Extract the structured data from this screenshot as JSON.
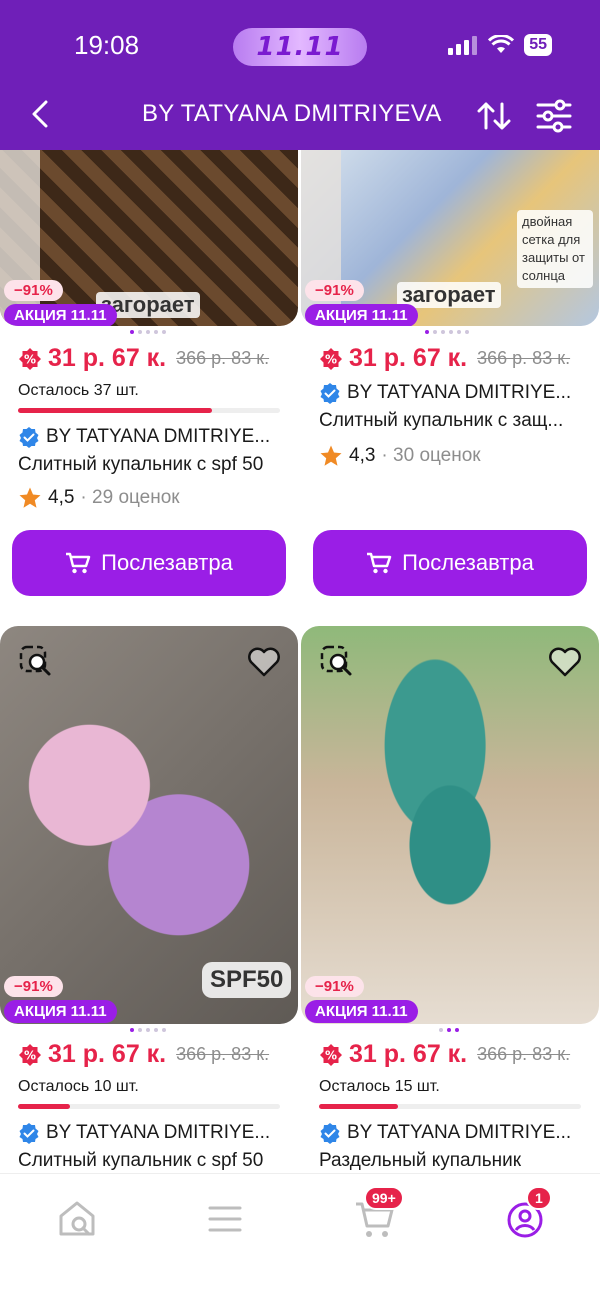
{
  "status_bar": {
    "time": "19:08",
    "promo": "11.11",
    "battery": "55"
  },
  "header": {
    "title": "BY TATYANA DMITRIYEVA"
  },
  "colors": {
    "header_bg": "#6f1fb8",
    "accent": "#9a1ee6",
    "price": "#e6234a"
  },
  "products": [
    {
      "discount": "−91%",
      "promo": "АКЦИЯ 11.11",
      "price": "31 р. 67 к.",
      "old_price": "366 р. 83 к.",
      "stock": "Осталось 37 шт.",
      "stock_fraction": 0.74,
      "brand": "BY TATYANA DMITRIYE...",
      "name": "Слитный купальник с spf 50",
      "rating": "4,5",
      "reviews": "· 29 оценок",
      "cta": "Послезавтра",
      "image_overlay": "загорает"
    },
    {
      "discount": "−91%",
      "promo": "АКЦИЯ 11.11",
      "price": "31 р. 67 к.",
      "old_price": "366 р. 83 к.",
      "brand": "BY TATYANA DMITRIYE...",
      "name": "Слитный купальник с защ...",
      "rating": "4,3",
      "reviews": "· 30 оценок",
      "cta": "Послезавтра",
      "image_overlay": "загорает",
      "image_note": "двойная сетка для защиты от солнца"
    },
    {
      "discount": "−91%",
      "promo": "АКЦИЯ 11.11",
      "price": "31 р. 67 к.",
      "old_price": "366 р. 83 к.",
      "stock": "Осталось 10 шт.",
      "stock_fraction": 0.2,
      "brand": "BY TATYANA DMITRIYE...",
      "name": "Слитный купальник с spf 50",
      "image_tag": "SPF50"
    },
    {
      "discount": "−91%",
      "promo": "АКЦИЯ 11.11",
      "price": "31 р. 67 к.",
      "old_price": "366 р. 83 к.",
      "stock": "Осталось 15 шт.",
      "stock_fraction": 0.3,
      "brand": "BY TATYANA DMITRIYE...",
      "name": "Раздельный купальник"
    }
  ],
  "tabbar": {
    "cart_badge": "99+",
    "profile_badge": "1"
  }
}
